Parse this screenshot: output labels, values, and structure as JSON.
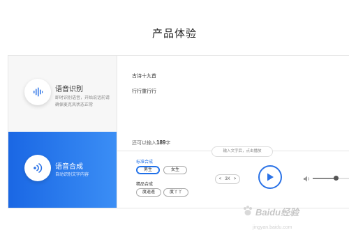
{
  "page_title": "产品体验",
  "sidebar": {
    "items": [
      {
        "name": "语音识别",
        "desc": "即时识别语音，开始说话前请确保麦克风状态正常",
        "icon": "waveform-icon",
        "active": false
      },
      {
        "name": "语音合成",
        "desc": "自动识别文字内容",
        "icon": "sound-wave-icon",
        "active": true
      }
    ]
  },
  "content": {
    "poem_title": "古诗十九首",
    "poem_line": "行行重行行",
    "count_prefix": "还可以输入",
    "count_value": "189",
    "count_suffix": "字",
    "hint": "输入文字后，点击播放"
  },
  "voices": {
    "standard_label": "标准合成",
    "standard": [
      "男生",
      "女生"
    ],
    "selected": "男生",
    "premium_label": "精品合成",
    "premium": [
      "度逍遥",
      "度丫丫"
    ]
  },
  "player": {
    "speed_left": "<",
    "speed_value": "3X",
    "speed_right": ">",
    "volume": 0.55,
    "accent": "#1e6fe8"
  },
  "watermark": {
    "brand": "Baidu经验",
    "sub": "jingyan.baidu.com"
  }
}
